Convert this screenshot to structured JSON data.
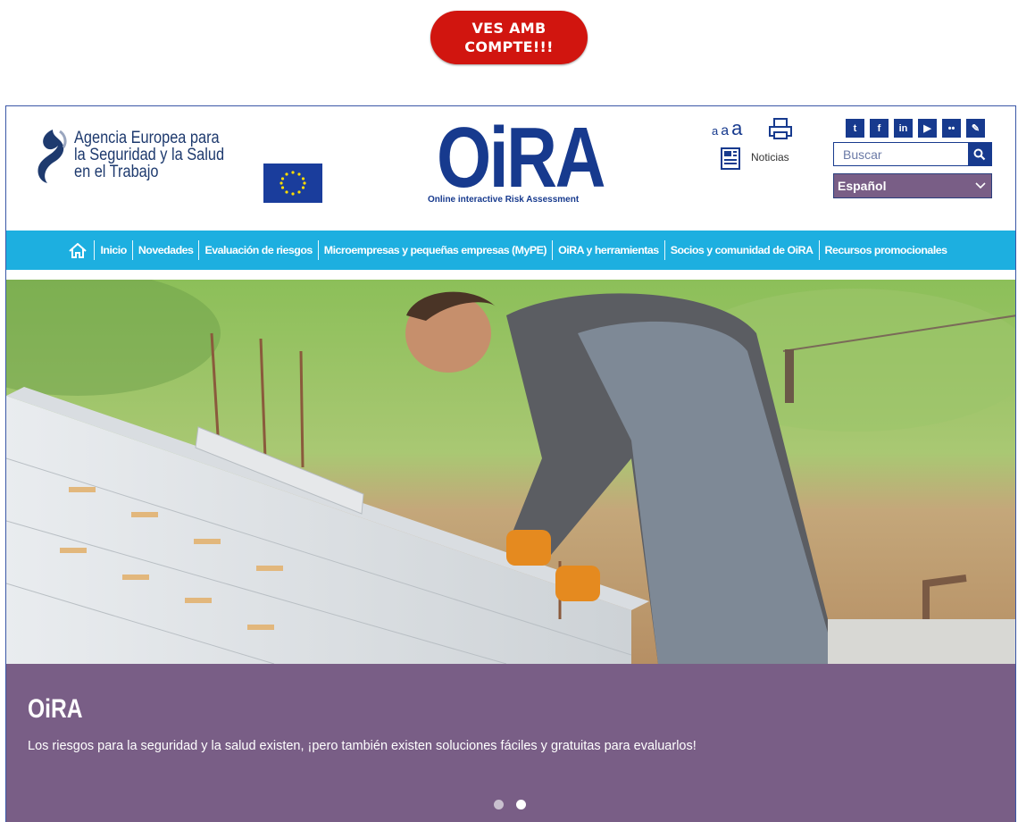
{
  "warning_badge": {
    "line1": "VES AMB",
    "line2": "COMPTE!!!",
    "color": "#d1150f"
  },
  "header": {
    "agency_name": [
      "Agencia Europea para",
      "la Seguridad y la Salud",
      "en el Trabajo"
    ],
    "logo_text": "OiRA",
    "logo_subtitle": "Online interactive Risk Assessment",
    "font_size_controls": [
      "a",
      "a",
      "a"
    ],
    "print_icon": "print-icon",
    "news_label": "Noticias",
    "social_icons": [
      "twitter-icon",
      "facebook-icon",
      "linkedin-icon",
      "youtube-icon",
      "flickr-icon",
      "blog-icon"
    ],
    "search": {
      "placeholder": "Buscar",
      "value": ""
    },
    "language": {
      "selected": "Español"
    }
  },
  "nav": {
    "items": [
      "Inicio",
      "Novedades",
      "Evaluación de riesgos",
      "Microempresas y pequeñas empresas (MyPE)",
      "OiRA y herramientas",
      "Socios y comunidad de OiRA",
      "Recursos promocionales"
    ]
  },
  "hero": {
    "title": "OiRA",
    "text": "Los riesgos para la seguridad y la salud existen, ¡pero también existen soluciones fáciles y gratuitas para evaluarlos!",
    "slides_total": 2,
    "active_slide": 2
  },
  "colors": {
    "brand_blue": "#173a8e",
    "nav_cyan": "#1dafe0",
    "caption_purple": "#795e86"
  }
}
